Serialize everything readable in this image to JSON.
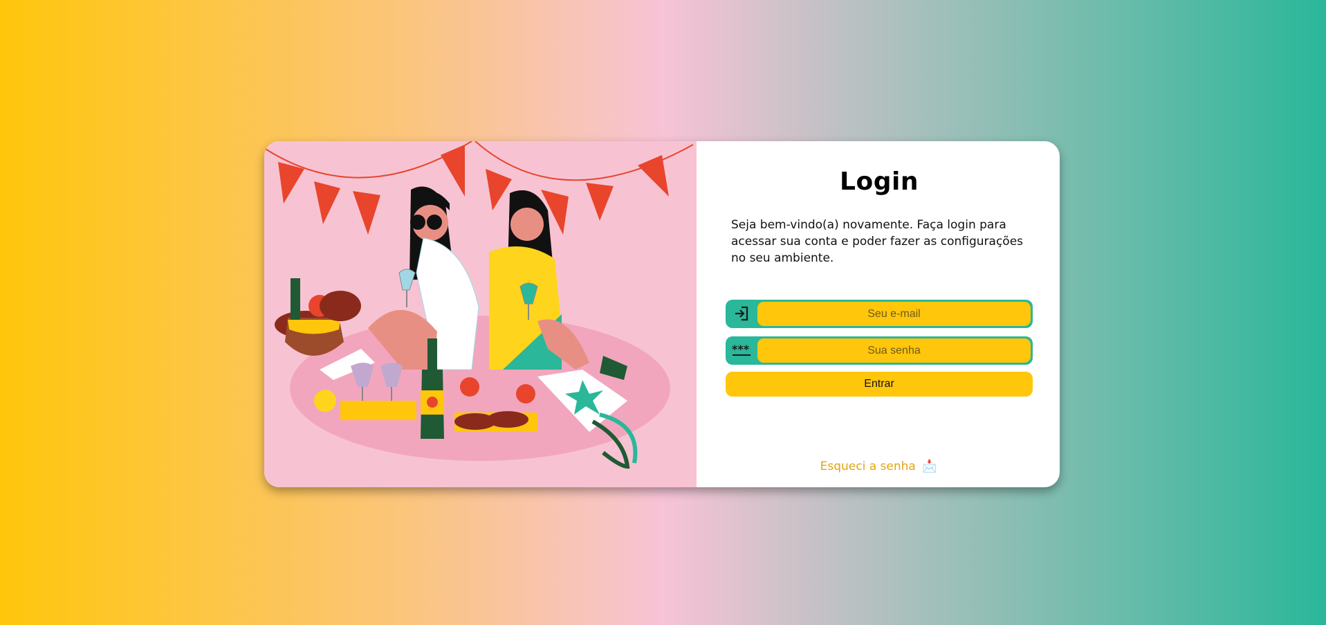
{
  "login": {
    "title": "Login",
    "welcome": "Seja bem-vindo(a) novamente. Faça login para acessar sua conta e poder fazer as configurações no seu ambiente.",
    "email_placeholder": "Seu e-mail",
    "password_placeholder": "Sua senha",
    "submit_label": "Entrar",
    "forgot_label": "Esqueci a senha",
    "forgot_icon": "📩"
  },
  "icons": {
    "email_field": "login-arrow-icon",
    "password_field": "password-asterisks-icon"
  },
  "colors": {
    "accent_yellow": "#ffc60b",
    "accent_teal": "#2ab79a",
    "illustration_bg": "#f7c3d3",
    "forgot_link": "#e2a413"
  },
  "illustration": {
    "description_icon": "picnic-illustration"
  }
}
